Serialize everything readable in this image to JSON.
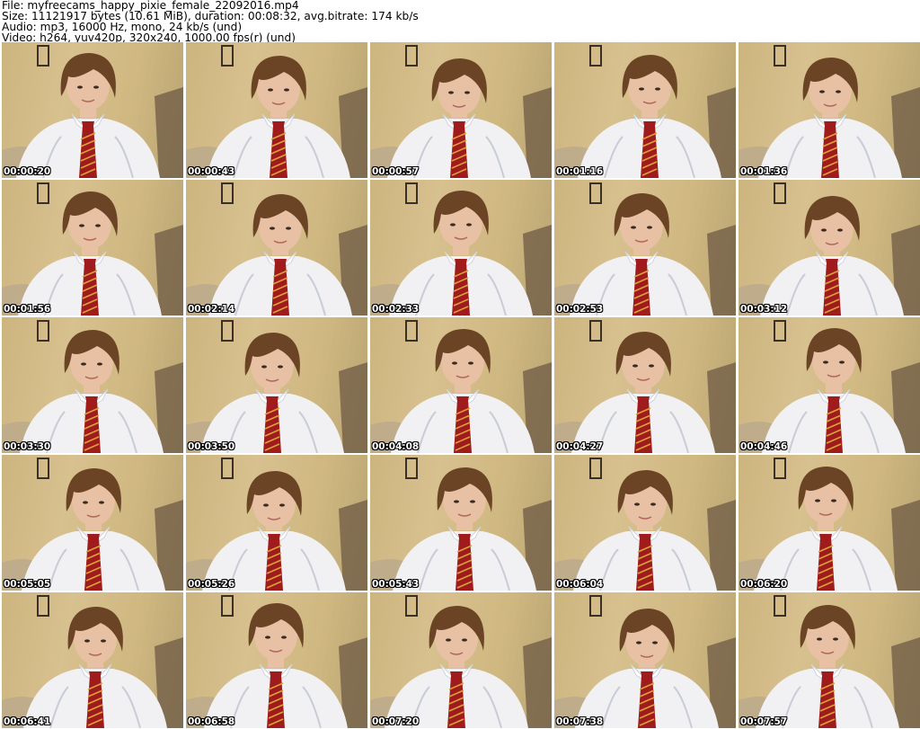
{
  "header": {
    "file": "File: myfreecams_happy_pixie_female_22092016.mp4",
    "size": "Size: 11121917 bytes (10.61 MiB), duration: 00:08:32, avg.bitrate: 174 kb/s",
    "audio": "Audio: mp3, 16000 Hz, mono, 24 kb/s (und)",
    "video": "Video: h264, yuv420p, 320x240, 1000.00 fps(r) (und)"
  },
  "thumbnails": [
    {
      "timestamp": "00:00:20"
    },
    {
      "timestamp": "00:00:43"
    },
    {
      "timestamp": "00:00:57"
    },
    {
      "timestamp": "00:01:16"
    },
    {
      "timestamp": "00:01:36"
    },
    {
      "timestamp": "00:01:56"
    },
    {
      "timestamp": "00:02:14"
    },
    {
      "timestamp": "00:02:33"
    },
    {
      "timestamp": "00:02:53"
    },
    {
      "timestamp": "00:03:12"
    },
    {
      "timestamp": "00:03:30"
    },
    {
      "timestamp": "00:03:50"
    },
    {
      "timestamp": "00:04:08"
    },
    {
      "timestamp": "00:04:27"
    },
    {
      "timestamp": "00:04:46"
    },
    {
      "timestamp": "00:05:05"
    },
    {
      "timestamp": "00:05:26"
    },
    {
      "timestamp": "00:05:43"
    },
    {
      "timestamp": "00:06:04"
    },
    {
      "timestamp": "00:06:20"
    },
    {
      "timestamp": "00:06:41"
    },
    {
      "timestamp": "00:06:58"
    },
    {
      "timestamp": "00:07:20"
    },
    {
      "timestamp": "00:07:38"
    },
    {
      "timestamp": "00:07:57"
    }
  ],
  "colors": {
    "wall": "#d5be8a",
    "hair": "#6b4426",
    "skin": "#e8c0a4",
    "shirt": "#f1f1f4",
    "tie": "#a01c1c",
    "tie_stripe": "#d9a23a",
    "frame": "#3a3028"
  }
}
